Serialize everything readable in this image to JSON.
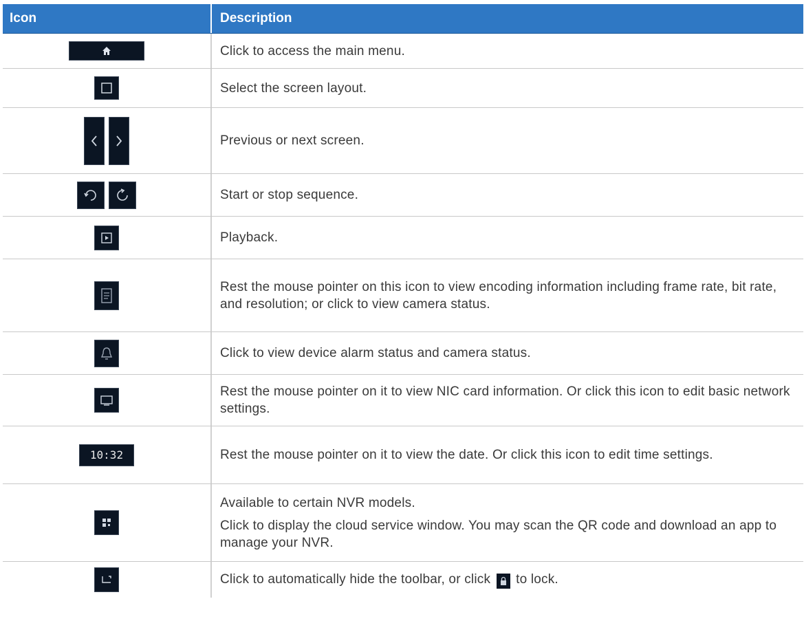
{
  "header": {
    "col_icon": "Icon",
    "col_desc": "Description"
  },
  "rows": [
    {
      "icons": [
        "home-icon"
      ],
      "desc": [
        "Click to access the main menu."
      ]
    },
    {
      "icons": [
        "screen-layout-icon"
      ],
      "desc": [
        "Select the screen layout."
      ]
    },
    {
      "icons": [
        "previous-screen-icon",
        "next-screen-icon"
      ],
      "desc": [
        "Previous or next screen."
      ]
    },
    {
      "icons": [
        "start-sequence-icon",
        "stop-sequence-icon"
      ],
      "desc": [
        "Start or stop sequence."
      ]
    },
    {
      "icons": [
        "playback-icon"
      ],
      "desc": [
        "Playback."
      ]
    },
    {
      "icons": [
        "encoding-info-icon"
      ],
      "desc": [
        "Rest the mouse pointer on this icon to view encoding information including frame rate, bit rate, and resolution; or click to view camera status."
      ]
    },
    {
      "icons": [
        "alarm-status-icon"
      ],
      "desc": [
        "Click to view device alarm status and camera status."
      ]
    },
    {
      "icons": [
        "network-icon"
      ],
      "desc": [
        "Rest the mouse pointer on it to view NIC card information. Or click this icon to edit basic network settings."
      ]
    },
    {
      "icons": [
        "clock-icon"
      ],
      "clock_text": "10:32",
      "desc": [
        "Rest the mouse pointer on it to view the date. Or click this icon to edit time settings."
      ]
    },
    {
      "icons": [
        "cloud-service-icon"
      ],
      "desc": [
        "Available to certain NVR models.",
        "Click to display the cloud service window. You may scan the QR code and download an app to manage your NVR."
      ]
    },
    {
      "icons": [
        "auto-hide-toolbar-icon"
      ],
      "desc_before": "Click to automatically hide the toolbar, or click",
      "desc_after": "to lock."
    }
  ],
  "colors": {
    "header_bg": "#2f78c4",
    "icon_bg": "#0b1523",
    "row_border": "#c8c8c8"
  }
}
